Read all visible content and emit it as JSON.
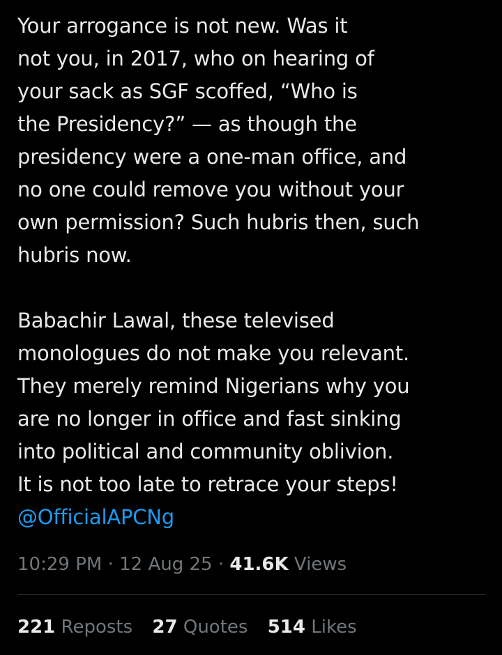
{
  "tweet": {
    "paragraph_1": [
      "Your arrogance is not new. Was it",
      "not you, in 2017, who on hearing of",
      "your sack as SGF scoffed, “Who is",
      "the Presidency?” — as though the",
      "presidency were a one-man office, and",
      "no one could remove you without your",
      "own permission? Such hubris then, such",
      "hubris now."
    ],
    "paragraph_2": [
      "Babachir Lawal, these televised",
      "monologues do not make you relevant.",
      "They merely remind Nigerians why you",
      "are no longer in office and fast sinking",
      "into political and community oblivion.",
      "It is not too late to retrace your steps!"
    ],
    "mention": "@OfficialAPCNg"
  },
  "meta": {
    "time": "10:29 PM",
    "separator": " · ",
    "date": "12 Aug 25",
    "views_count": "41.6K",
    "views_label": " Views"
  },
  "stats": {
    "reposts_count": "221",
    "reposts_label": " Reposts",
    "quotes_count": "27",
    "quotes_label": " Quotes",
    "likes_count": "514",
    "likes_label": " Likes"
  },
  "colors": {
    "background": "#000000",
    "text": "#e7e9ea",
    "muted": "#71767b",
    "link": "#1d9bf0",
    "divider": "#2f3336"
  }
}
